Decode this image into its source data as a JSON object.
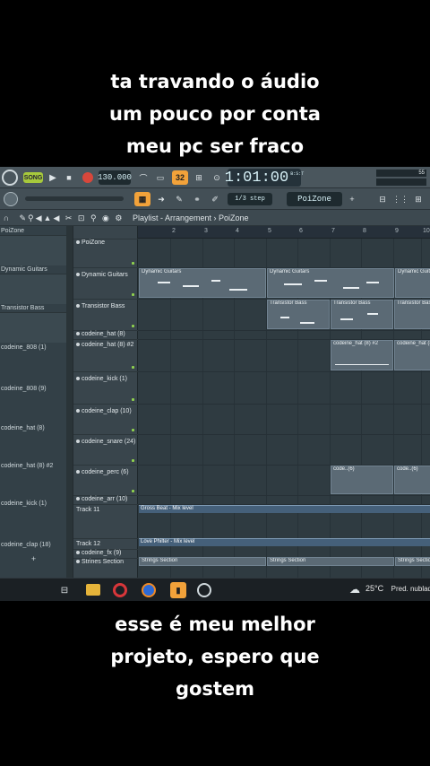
{
  "caption_top": [
    "ta travando o áudio",
    "um pouco por conta",
    "meu pc ser fraco"
  ],
  "caption_bottom": [
    "esse é meu melhor",
    "projeto, espero que",
    "gostem"
  ],
  "toolbar": {
    "song_label": "SONG",
    "tempo": "130.000",
    "time": "1:01:00",
    "time_sub": "B:S:T",
    "cpu": "55",
    "step_label": "1/3 step",
    "pattern_name": "PoiZone",
    "orange_label": "32"
  },
  "breadcrumb": "Playlist - Arrangement › PoiZone",
  "browser_items": [
    "PoiZone",
    "Dynamic Guitars",
    "Transistor Bass",
    "codeine_808 (1)",
    "codeine_808 (9)",
    "codeine_hat (8)",
    "codeine_hat (8) #2",
    "codeine_kick (1)",
    "codeine_clap (18)",
    "+"
  ],
  "tracks": [
    "PoiZone",
    "Dynamic Guitars",
    "Transistor Bass",
    "codeine_hat (8)",
    "codeine_hat (8) #2",
    "codeine_kick (1)",
    "codeine_clap (10)",
    "codeine_snare (24)",
    "codeine_perc (6)",
    "codeine_arr (10)",
    "Track 11",
    "Track 12",
    "codeine_fx (9)",
    "Strines Section"
  ],
  "ruler_bars": [
    "2",
    "3",
    "4",
    "5",
    "6",
    "7",
    "8",
    "9",
    "10"
  ],
  "clips": {
    "dynamic_guitars": "Dynamic Guitars",
    "transistor_bass": "Transistor Bass",
    "hat2": "codeine_hat (8) #2",
    "perc": "code..(6)",
    "gross_beat": "Gross Beat - Mix level",
    "love_philter": "Love Philter - Mix level",
    "strings": "Strings Section"
  },
  "taskbar": {
    "temperature": "25°C",
    "weather": "Pred. nublad"
  },
  "colors": {
    "fl_bg": "#3a464d",
    "song_button": "#a7c93c",
    "accent_orange": "#f2a23a",
    "clip": "#5b6a75"
  }
}
